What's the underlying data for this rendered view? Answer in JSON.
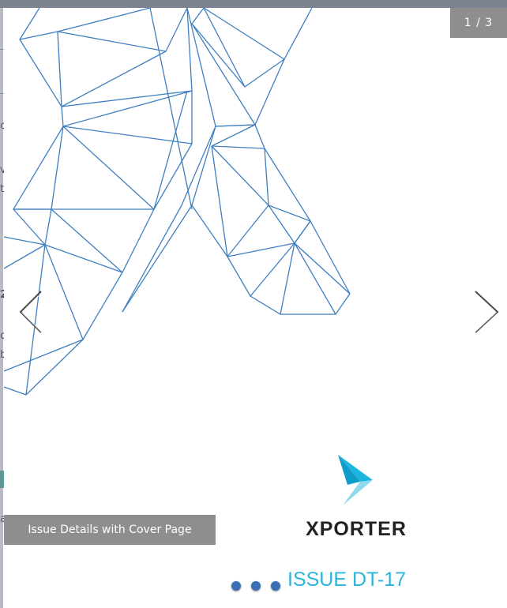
{
  "lightbox": {
    "counter": "1 / 3",
    "caption": "Issue Details with Cover Page",
    "slide_count": 3,
    "active_slide": 1
  },
  "cover": {
    "brand": "XPORTER",
    "issue": "ISSUE DT-17"
  },
  "background_page": {
    "visible_fragments": [
      "c",
      "v",
      "t",
      "2",
      "o",
      "b",
      "a"
    ]
  },
  "icons": {
    "prev": "chevron-left-icon",
    "next": "chevron-right-icon",
    "logo": "xporter-arrow-logo"
  },
  "colors": {
    "accent": "#2cb4dc",
    "wireframe": "#3f7fc0",
    "overlay": "#8e8e8e",
    "dot": "#3a6fb5"
  }
}
